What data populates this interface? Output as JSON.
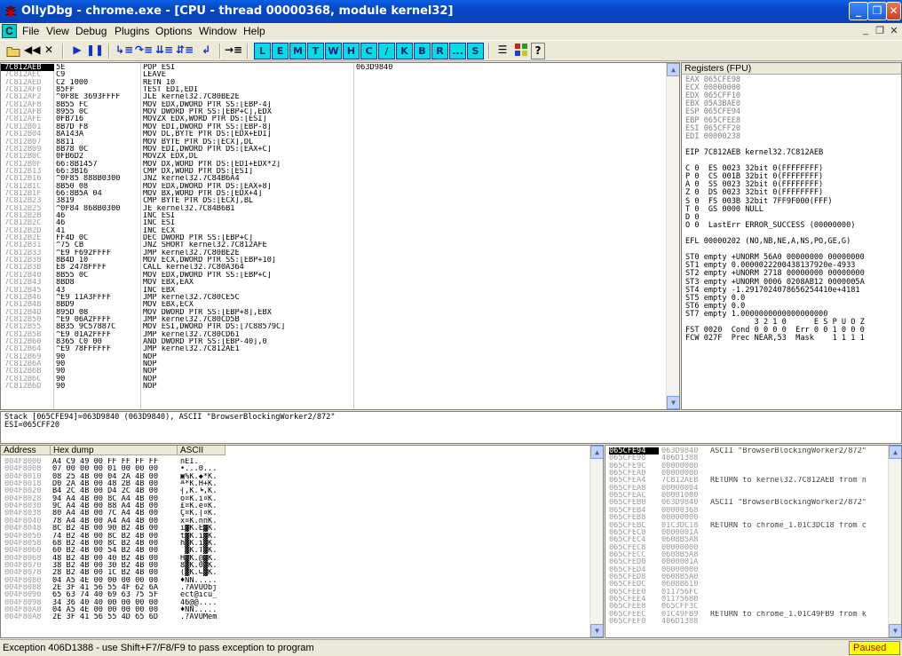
{
  "window": {
    "title": "OllyDbg - chrome.exe - [CPU - thread 00000368, module kernel32]",
    "minimize": "_",
    "restore": "❐",
    "close": "✕"
  },
  "menu": {
    "items": [
      "File",
      "View",
      "Debug",
      "Plugins",
      "Options",
      "Window",
      "Help"
    ],
    "mdi": [
      "_",
      "❐",
      "✕"
    ],
    "app_icon": "C"
  },
  "toolbar": {
    "left_icons": [
      "open-icon",
      "rewind-icon",
      "close-icon",
      "run-icon",
      "pause-icon",
      "step-into-icon",
      "step-over-icon",
      "trace-into-icon",
      "trace-over-icon",
      "execute-till-return-icon",
      "goto-icon"
    ],
    "letters": [
      "L",
      "E",
      "M",
      "T",
      "W",
      "H",
      "C",
      "/",
      "K",
      "B",
      "R",
      "...",
      "S"
    ],
    "right_icons": [
      "list-icon",
      "grid-icon",
      "help-icon"
    ]
  },
  "cpu": {
    "rows": [
      [
        "7C812AEB",
        "5E",
        "POP ESI",
        "063D9840"
      ],
      [
        "7C812AEC",
        "C9",
        "LEAVE",
        ""
      ],
      [
        "7C812AED",
        "C2 1000",
        "RETN 10",
        ""
      ],
      [
        "7C812AF0",
        "85FF",
        "TEST EDI,EDI",
        ""
      ],
      [
        "7C812AF2",
        "^0F8E 3693FFFF",
        "JLE kernel32.7C80BE2E",
        ""
      ],
      [
        "7C812AF8",
        "8B55 FC",
        "MOV EDX,DWORD PTR SS:[EBP-4]",
        ""
      ],
      [
        "7C812AFB",
        "8955 0C",
        "MOV DWORD PTR SS:[EBP+C],EDX",
        ""
      ],
      [
        "7C812AFE",
        "0FB716",
        "MOVZX EDX,WORD PTR DS:[ESI]",
        ""
      ],
      [
        "7C812B01",
        "8B7D F8",
        "MOV EDI,DWORD PTR SS:[EBP-8]",
        ""
      ],
      [
        "7C812B04",
        "8A143A",
        "MOV DL,BYTE PTR DS:[EDX+EDI]",
        ""
      ],
      [
        "7C812B07",
        "8811",
        "MOV BYTE PTR DS:[ECX],DL",
        ""
      ],
      [
        "7C812B09",
        "8B78 0C",
        "MOV EDI,DWORD PTR DS:[EAX+C]",
        ""
      ],
      [
        "7C812B0C",
        "0FB6D2",
        "MOVZX EDX,DL",
        ""
      ],
      [
        "7C812B0F",
        "66:8B1457",
        "MOV DX,WORD PTR DS:[EDI+EDX*2]",
        ""
      ],
      [
        "7C812B13",
        "66:3B16",
        "CMP DX,WORD PTR DS:[ESI]",
        ""
      ],
      [
        "7C812B16",
        "^0F85 888B0300",
        "JNZ kernel32.7C84B6A4",
        ""
      ],
      [
        "7C812B1C",
        "8B50 08",
        "MOV EDX,DWORD PTR DS:[EAX+8]",
        ""
      ],
      [
        "7C812B1F",
        "66:8B5A 04",
        "MOV BX,WORD PTR DS:[EDX+4]",
        ""
      ],
      [
        "7C812B23",
        "3819",
        "CMP BYTE PTR DS:[ECX],BL",
        ""
      ],
      [
        "7C812B25",
        "^0F84 868B0300",
        "JE kernel32.7C84B6B1",
        ""
      ],
      [
        "7C812B2B",
        "46",
        "INC ESI",
        ""
      ],
      [
        "7C812B2C",
        "46",
        "INC ESI",
        ""
      ],
      [
        "7C812B2D",
        "41",
        "INC ECX",
        ""
      ],
      [
        "7C812B2E",
        "FF4D 0C",
        "DEC DWORD PTR SS:[EBP+C]",
        ""
      ],
      [
        "7C812B31",
        "^75 CB",
        "JNZ SHORT kernel32.7C812AFE",
        ""
      ],
      [
        "7C812B33",
        "^E9 F692FFFF",
        "JMP kernel32.7C80BE2E",
        ""
      ],
      [
        "7C812B38",
        "8B4D 10",
        "MOV ECX,DWORD PTR SS:[EBP+10]",
        ""
      ],
      [
        "7C812B3B",
        "E8 2478FFFF",
        "CALL kernel32.7C80A364",
        ""
      ],
      [
        "7C812B40",
        "8B55 0C",
        "MOV EDX,DWORD PTR SS:[EBP+C]",
        ""
      ],
      [
        "7C812B43",
        "8BD8",
        "MOV EBX,EAX",
        ""
      ],
      [
        "7C812B45",
        "43",
        "INC EBX",
        ""
      ],
      [
        "7C812B46",
        "^E9 11A3FFFF",
        "JMP kernel32.7C80CE5C",
        ""
      ],
      [
        "7C812B4B",
        "8BD9",
        "MOV EBX,ECX",
        ""
      ],
      [
        "7C812B4D",
        "895D 08",
        "MOV DWORD PTR SS:[EBP+8],EBX",
        ""
      ],
      [
        "7C812B50",
        "^E9 06A2FFFF",
        "JMP kernel32.7C80CD5B",
        ""
      ],
      [
        "7C812B55",
        "8B35 9C57887C",
        "MOV ESI,DWORD PTR DS:[7C88579C]",
        ""
      ],
      [
        "7C812B5B",
        "^E9 01A2FFFF",
        "JMP kernel32.7C80CD61",
        ""
      ],
      [
        "7C812B60",
        "8365 C0 00",
        "AND DWORD PTR SS:[EBP-40],0",
        ""
      ],
      [
        "7C812B64",
        "^E9 78FFFFFF",
        "JMP kernel32.7C812AE1",
        ""
      ],
      [
        "7C812B69",
        "90",
        "NOP",
        ""
      ],
      [
        "7C812B6A",
        "90",
        "NOP",
        ""
      ],
      [
        "7C812B6B",
        "90",
        "NOP",
        ""
      ],
      [
        "7C812B6C",
        "90",
        "NOP",
        ""
      ],
      [
        "7C812B6D",
        "90",
        "NOP",
        ""
      ]
    ]
  },
  "registers": {
    "title": "Registers (FPU)",
    "lines": [
      "EAX 065CFE98",
      "ECX 00000000",
      "EDX 065CFF10",
      "EBX 05A3BAE0",
      "ESP 065CFE94",
      "EBP 065CFEE8",
      "ESI 065CFF20",
      "EDI 00000238",
      "",
      "EIP 7C812AEB kernel32.7C812AEB",
      "",
      "C 0  ES 0023 32bit 0(FFFFFFFF)",
      "P 0  CS 001B 32bit 0(FFFFFFFF)",
      "A 0  SS 0023 32bit 0(FFFFFFFF)",
      "Z 0  DS 0023 32bit 0(FFFFFFFF)",
      "S 0  FS 003B 32bit 7FF9F000(FFF)",
      "T 0  GS 0000 NULL",
      "D 0",
      "O 0  LastErr ERROR_SUCCESS (00000000)",
      "",
      "EFL 00000202 (NO,NB,NE,A,NS,PO,GE,G)",
      "",
      "ST0 empty +UNORM 56A0 00000000 00000000",
      "ST1 empty 0.0000022200438137920e-4933",
      "ST2 empty +UNORM 2718 00000000 00000000",
      "ST3 empty +UNORM 0006 0208AB12 0000005A",
      "ST4 empty -1.2917024078656254410e+4181",
      "ST5 empty 0.0",
      "ST6 empty 0.0",
      "ST7 empty 1.0000000000000000000",
      "               3 2 1 0      E S P U O Z",
      "FST 0020  Cond 0 0 0 0  Err 0 0 1 0 0 0",
      "FCW 027F  Prec NEAR,53  Mask    1 1 1 1"
    ]
  },
  "info": {
    "lines": [
      "Stack [065CFE94]=063D9840 (063D9840), ASCII \"BrowserBlockingWorker2/872\"",
      "ESI=065CFF20"
    ]
  },
  "dump": {
    "headers": [
      "Address",
      "Hex dump",
      "ASCII"
    ],
    "rows": [
      [
        "004F8000",
        "A4 C9 49 00 FF FF FF FF",
        "ñÉI."
      ],
      [
        "004F8008",
        "07 00 00 00 01 00 00 00",
        "•...0..."
      ],
      [
        "004F8010",
        "08 25 4B 00 04 2A 4B 00",
        "▣%K.◆*K."
      ],
      [
        "004F8018",
        "D0 2A 4B 00 48 2B 4B 00",
        "╨*K.H+K."
      ],
      [
        "004F8020",
        "B4 2C 4B 00 D4 2C 4B 00",
        "┤,K.╘,K."
      ],
      [
        "004F8028",
        "94 A4 4B 00 8C A4 4B 00",
        "ö¤K.î¤K."
      ],
      [
        "004F8030",
        "9C A4 4B 00 88 A4 4B 00",
        "£¤K.ê¤K."
      ],
      [
        "004F8038",
        "80 A4 4B 00 7C A4 4B 00",
        "Ç¤K.|¤K."
      ],
      [
        "004F8040",
        "78 A4 4B 00 A4 A4 4B 00",
        "x¤K.ññK."
      ],
      [
        "004F8048",
        "8C B2 4B 00 90 B2 4B 00",
        "î▓K.É▓K."
      ],
      [
        "004F8050",
        "74 B2 4B 00 8C B2 4B 00",
        "t▓K.î▓K."
      ],
      [
        "004F8058",
        "68 B2 4B 00 8C B2 4B 00",
        "h▓K.î▓K."
      ],
      [
        "004F8060",
        "60 B2 4B 00 54 B2 4B 00",
        "`▓K.T▓K."
      ],
      [
        "004F8068",
        "48 B2 4B 00 40 B2 4B 00",
        "H▓K.@▓K."
      ],
      [
        "004F8070",
        "38 B2 4B 00 30 B2 4B 00",
        "8▓K.0▓K."
      ],
      [
        "004F8078",
        "28 B2 4B 00 1C B2 4B 00",
        "(▓K.∟▓K."
      ],
      [
        "004F8080",
        "04 A5 4E 00 00 00 00 00",
        "♦ÑN....."
      ],
      [
        "004F8088",
        "2E 3F 41 56 55 4F 62 6A",
        ".?AVUObj"
      ],
      [
        "004F8090",
        "65 63 74 40 69 63 75 5F",
        "ect@icu_"
      ],
      [
        "004F8098",
        "34 36 40 40 00 00 00 00",
        "46@@...."
      ],
      [
        "004F80A0",
        "04 A5 4E 00 00 00 00 00",
        "♦ÑN....."
      ],
      [
        "004F80A8",
        "2E 3F 41 56 55 4D 65 6D",
        ".?AVUMem"
      ]
    ]
  },
  "stack": {
    "rows": [
      [
        "065CFE94",
        "063D9840",
        "ASCII \"BrowserBlockingWorker2/872\""
      ],
      [
        "065CFE98",
        "406D1388",
        ""
      ],
      [
        "065CFE9C",
        "00000000",
        ""
      ],
      [
        "065CFEA0",
        "00000000",
        ""
      ],
      [
        "065CFEA4",
        "7C812AEB",
        "RETURN to kernel32.7C812AEB from n"
      ],
      [
        "065CFEA8",
        "00000004",
        ""
      ],
      [
        "065CFEAC",
        "00001000",
        ""
      ],
      [
        "065CFEB0",
        "063D9840",
        "ASCII \"BrowserBlockingWorker2/872\""
      ],
      [
        "065CFEB4",
        "00000368",
        ""
      ],
      [
        "065CFEB8",
        "00000000",
        ""
      ],
      [
        "065CFEBC",
        "01C3DC18",
        "RETURN to chrome_1.01C3DC18 from c"
      ],
      [
        "065CFEC0",
        "0000001A",
        ""
      ],
      [
        "065CFEC4",
        "0608B5A8",
        ""
      ],
      [
        "065CFEC8",
        "00000000",
        ""
      ],
      [
        "065CFECC",
        "0608B5A8",
        ""
      ],
      [
        "065CFED0",
        "0000001A",
        ""
      ],
      [
        "065CFED4",
        "00000000",
        ""
      ],
      [
        "065CFED8",
        "0608B5A0",
        ""
      ],
      [
        "065CFEDC",
        "0608B610",
        ""
      ],
      [
        "065CFEE0",
        "011756FC",
        ""
      ],
      [
        "065CFEE4",
        "01175680",
        ""
      ],
      [
        "065CFEE8",
        "065CFF3C",
        ""
      ],
      [
        "065CFEEC",
        "01C49FB9",
        "RETURN to chrome_1.01C49FB9 from k"
      ],
      [
        "065CFEF0",
        "406D1388",
        ""
      ]
    ]
  },
  "status": {
    "text": "Exception 406D1388 - use Shift+F7/F8/F9 to pass exception to program",
    "state": "Paused"
  }
}
